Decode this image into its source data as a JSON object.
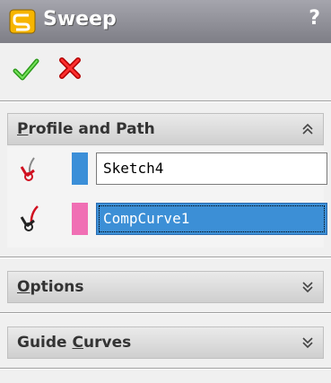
{
  "title_bar": {
    "title": "Sweep",
    "help_label": "?"
  },
  "actions": {
    "ok_icon": "green-checkmark",
    "cancel_icon": "red-x"
  },
  "sections": {
    "profile_and_path": {
      "title_pre": "",
      "title_mnemonic": "P",
      "title_post": "rofile and Path",
      "state": "expanded",
      "profile_value": "Sketch4",
      "profile_color": "#3b8fd8",
      "path_value": "CompCurve1",
      "path_color": "#f06fb4",
      "path_selected": true
    },
    "options": {
      "title_pre": "",
      "title_mnemonic": "O",
      "title_post": "ptions",
      "state": "collapsed"
    },
    "guide_curves": {
      "title_pre": "Guide ",
      "title_mnemonic": "C",
      "title_post": "urves",
      "state": "collapsed"
    }
  },
  "colors": {
    "title_bar": "#8d8d95",
    "panel_bg": "#f0f0f0",
    "selection_bg": "#3c8fd6"
  }
}
